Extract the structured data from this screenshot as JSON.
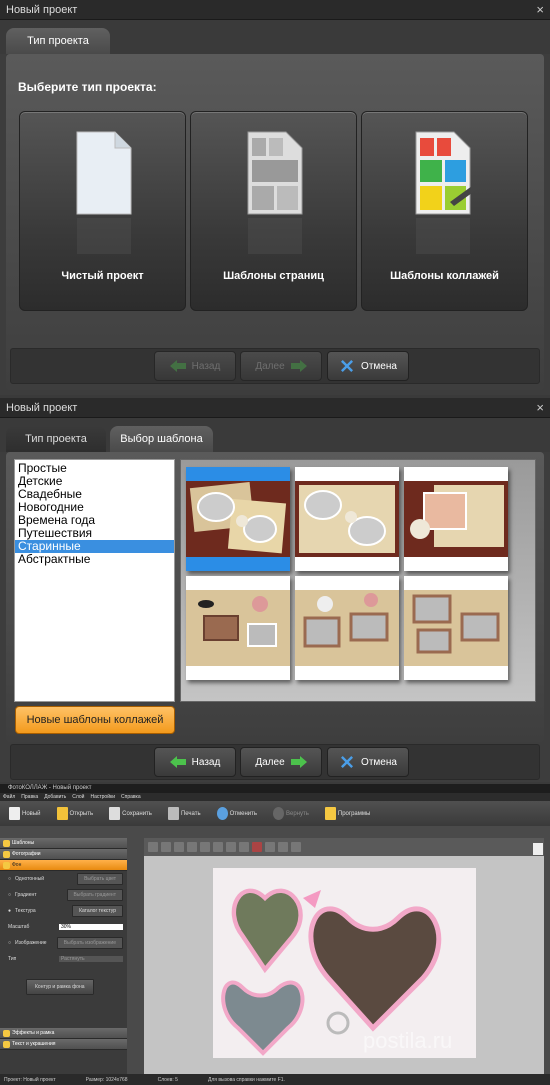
{
  "dialog1": {
    "title": "Новый проект",
    "close": "×",
    "tab": "Тип проекта",
    "heading": "Выберите тип проекта:",
    "cards": [
      {
        "label": "Чистый проект",
        "icon": "blank-page-icon"
      },
      {
        "label": "Шаблоны страниц",
        "icon": "page-template-icon"
      },
      {
        "label": "Шаблоны коллажей",
        "icon": "collage-template-icon"
      }
    ],
    "buttons": {
      "back": "Назад",
      "next": "Далее",
      "cancel": "Отмена"
    }
  },
  "dialog2": {
    "title": "Новый проект",
    "close": "×",
    "tabs": [
      "Тип проекта",
      "Выбор шаблона"
    ],
    "categories": [
      "Простые",
      "Детские",
      "Свадебные",
      "Новогодние",
      "Времена года",
      "Путешествия",
      "Старинные",
      "Абстрактные"
    ],
    "selected_category": "Старинные",
    "new_templates_button": "Новые шаблоны коллажей",
    "buttons": {
      "back": "Назад",
      "next": "Далее",
      "cancel": "Отмена"
    }
  },
  "app": {
    "title": "ФотоКОЛЛАЖ - Новый проект",
    "menu": [
      "Файл",
      "Правка",
      "Добавить",
      "Слой",
      "Настройки",
      "Справка"
    ],
    "toolbar": [
      "Новый",
      "Открыть",
      "Сохранить",
      "Печать",
      "Отменить",
      "Вернуть",
      "Программы"
    ],
    "panels": [
      "Шаблоны",
      "Фотографии",
      "Фон",
      "Эффекты и рамка",
      "Текст и украшения"
    ],
    "bg": {
      "solid": "Однотонный",
      "pick_color": "Выбрать цвет",
      "gradient": "Градиент",
      "pick_gradient": "Выбрать градиент",
      "texture": "Текстура",
      "texture_catalog": "Каталог текстур",
      "scale_label": "Масштаб",
      "scale_value": "30%",
      "image": "Изображение",
      "pick_image": "Выбрать изображение",
      "type_label": "Тип",
      "type_value": "Растянуть",
      "contour": "Контур и рамка фона"
    },
    "status": {
      "project": "Проект: Новый проект",
      "size": "Размер: 1024x768",
      "layers": "Слоев: 5",
      "hint": "Для вызова справки нажмите F1."
    },
    "watermark": "postila.ru"
  }
}
